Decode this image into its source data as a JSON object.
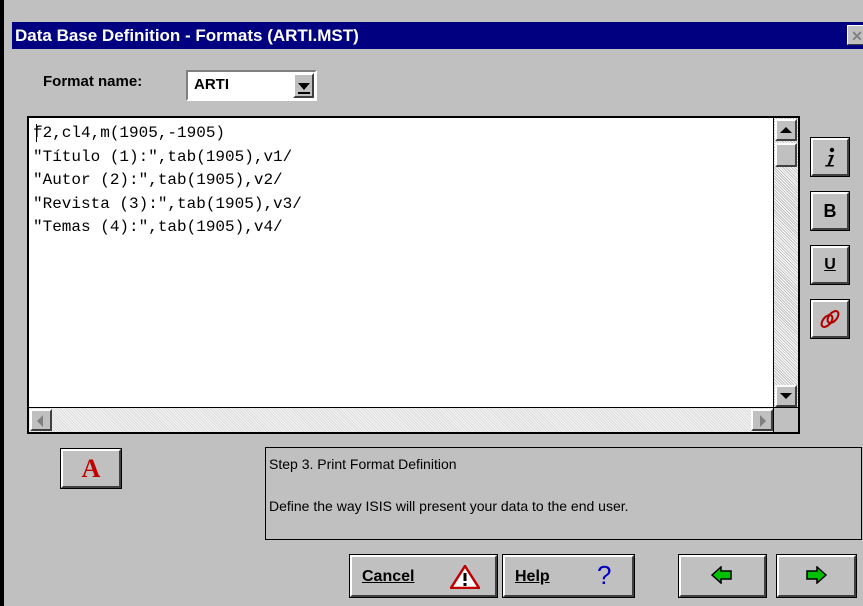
{
  "window": {
    "title": "Data Base Definition - Formats (ARTI.MST)"
  },
  "format": {
    "label": "Format name:",
    "selected": "ARTI"
  },
  "editor": {
    "lines": [
      "f2,cl4,m(1905,-1905)",
      "\"Título (1):\",tab(1905),v1/",
      "\"Autor (2):\",tab(1905),v2/",
      "\"Revista (3):\",tab(1905),v3/",
      "\"Temas (4):\",tab(1905),v4/"
    ]
  },
  "toolbar": {
    "italic_icon": "italic-icon",
    "bold_label": "B",
    "underline_label": "U",
    "link_icon": "chain-link-icon"
  },
  "font_button": {
    "label": "A"
  },
  "step": {
    "title": "Step 3. Print Format Definition",
    "description": "Define the way ISIS will present your data to the end user."
  },
  "buttons": {
    "cancel": "Cancel",
    "help": "Help",
    "help_glyph": "?"
  },
  "colors": {
    "titlebar": "#000080",
    "face": "#c0c0c0",
    "font_button_accent": "#c00000",
    "arrow": "#00c000"
  }
}
